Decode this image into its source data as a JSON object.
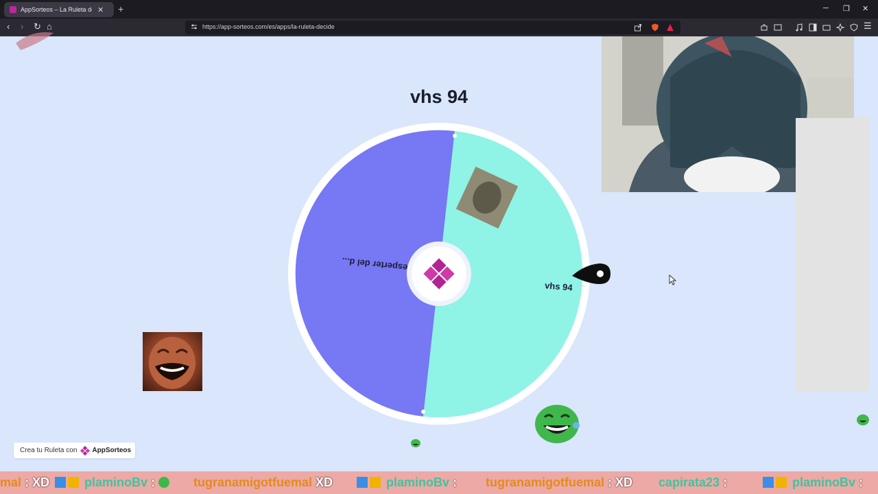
{
  "browser": {
    "tab_title": "AppSorteos – La Ruleta de la",
    "url": "https://app-sorteos.com/es/apps/la-ruleta-decide"
  },
  "page": {
    "result_title": "vhs 94",
    "promo_text": "Crea tu Ruleta con",
    "promo_brand": "AppSorteos"
  },
  "wheel": {
    "segments": [
      {
        "label": "el desperter del d...",
        "color": "#7678f4"
      },
      {
        "label": "vhs 94",
        "color": "#8ff3e6"
      }
    ],
    "center_color": "#b32493"
  },
  "chat": {
    "items": [
      {
        "name": "mal",
        "msg": ": XD",
        "name_color": "orange"
      },
      {
        "name": "plaminoBv",
        "msg": ":",
        "name_color": "teal"
      },
      {
        "name": "tugranamigotfuemal",
        "msg": "XD",
        "name_color": "orange"
      },
      {
        "name": "plaminoBv",
        "msg": ":",
        "name_color": "teal"
      },
      {
        "name": "tugranamigotfuemal",
        "msg": ": XD",
        "name_color": "orange"
      },
      {
        "name": "capirata23",
        "msg": ":",
        "name_color": "teal"
      },
      {
        "name": "plaminoBv",
        "msg": ":",
        "name_color": "teal"
      }
    ]
  }
}
